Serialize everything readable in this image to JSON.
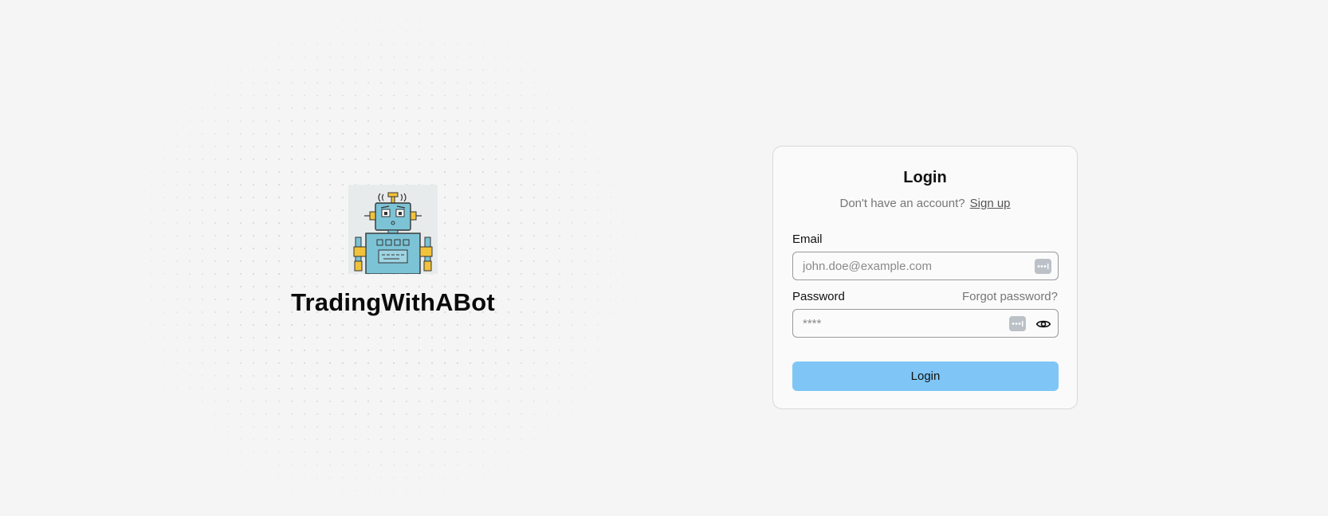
{
  "brand": {
    "name": "TradingWithABot",
    "logo_icon": "robot-icon"
  },
  "login_card": {
    "title": "Login",
    "signup_prompt": "Don't have an account?",
    "signup_link": "Sign up",
    "email": {
      "label": "Email",
      "placeholder": "john.doe@example.com",
      "value": ""
    },
    "password": {
      "label": "Password",
      "placeholder": "****",
      "value": "",
      "forgot_label": "Forgot password?"
    },
    "submit_label": "Login"
  },
  "colors": {
    "background": "#f5f5f5",
    "button": "#7fc6f6",
    "robot_body": "#7cc3d6",
    "robot_accent": "#f2c23a"
  }
}
